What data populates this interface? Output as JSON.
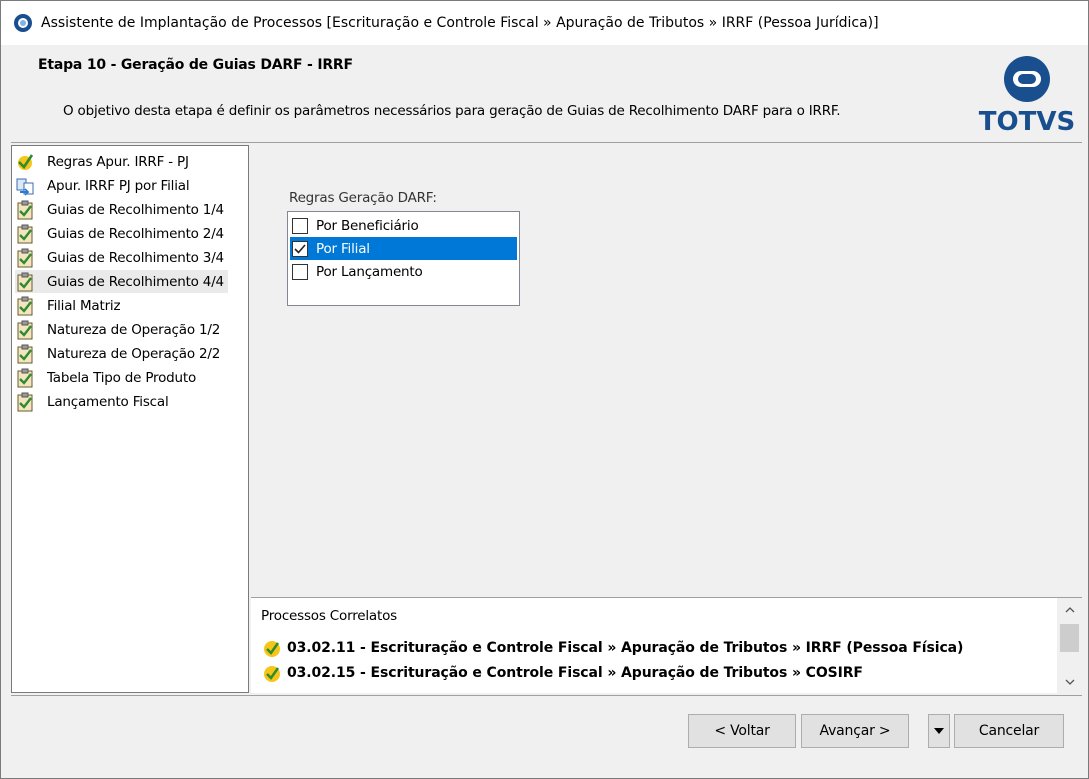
{
  "window": {
    "title": "Assistente de Implantação de Processos [Escrituração e Controle Fiscal » Apuração de Tributos » IRRF (Pessoa Jurídica)]"
  },
  "header": {
    "step_title": "Etapa 10 - Geração de Guias DARF - IRRF",
    "description": "O objetivo desta etapa é definir os parâmetros necessários para geração de Guias de Recolhimento DARF para o IRRF.",
    "logo_text": "TOTVS",
    "logo_color": "#1a4f8f"
  },
  "steps": [
    {
      "label": "Regras Apur. IRRF - PJ",
      "icon": "check-star-icon"
    },
    {
      "label": "Apur. IRRF PJ por Filial",
      "icon": "transfer-icon"
    },
    {
      "label": "Guias de Recolhimento 1/4",
      "icon": "clipboard-check-icon"
    },
    {
      "label": "Guias de Recolhimento 2/4",
      "icon": "clipboard-check-icon"
    },
    {
      "label": "Guias de Recolhimento 3/4",
      "icon": "clipboard-check-icon"
    },
    {
      "label": "Guias de Recolhimento 4/4",
      "icon": "clipboard-check-icon",
      "selected": true
    },
    {
      "label": "Filial Matriz",
      "icon": "clipboard-check-icon"
    },
    {
      "label": "Natureza de Operação 1/2",
      "icon": "clipboard-check-icon"
    },
    {
      "label": "Natureza de Operação 2/2",
      "icon": "clipboard-check-icon"
    },
    {
      "label": "Tabela Tipo de Produto",
      "icon": "clipboard-check-icon"
    },
    {
      "label": "Lançamento Fiscal",
      "icon": "clipboard-check-icon"
    }
  ],
  "form": {
    "group_label": "Regras Geração DARF:",
    "options": [
      {
        "label": "Por Beneficiário",
        "checked": false,
        "selected": false
      },
      {
        "label": "Por Filial",
        "checked": true,
        "selected": true
      },
      {
        "label": "Por Lançamento",
        "checked": false,
        "selected": false
      }
    ],
    "selection_color": "#0078d7"
  },
  "related": {
    "title": "Processos Correlatos",
    "items": [
      "03.02.11 - Escrituração e Controle Fiscal » Apuração de Tributos » IRRF (Pessoa Física)",
      "03.02.15 - Escrituração e Controle Fiscal » Apuração de Tributos » COSIRF"
    ]
  },
  "footer": {
    "back_label": "< Voltar",
    "next_label": "Avançar >",
    "cancel_label": "Cancelar"
  }
}
